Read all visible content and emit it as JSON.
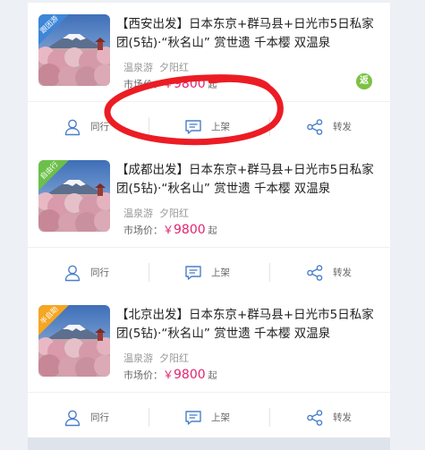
{
  "colors": {
    "price_accent": "#e0256f",
    "badge_blue": "#3d86d8",
    "badge_green": "#6cc04a",
    "badge_orange": "#f5a623",
    "fan_badge": "#7cc242",
    "annotation_red": "#ec1c24"
  },
  "cards": [
    {
      "badge": "跟团游",
      "title": "【西安出发】日本东京+群马县+日光市5日私家团(5钻)·“秋名山” 赏世遗 千本樱 双温泉",
      "tags": [
        "温泉游",
        "夕阳红"
      ],
      "price_label": "市场价：",
      "currency": "￥",
      "price": "9800",
      "price_suffix": "起",
      "fan_badge": "返",
      "actions": {
        "peer": "同行",
        "list": "上架",
        "share": "转发"
      }
    },
    {
      "badge": "自由行",
      "title": "【成都出发】日本东京+群马县+日光市5日私家团(5钻)·“秋名山” 赏世遗 千本樱 双温泉",
      "tags": [
        "温泉游",
        "夕阳红"
      ],
      "price_label": "市场价：",
      "currency": "￥",
      "price": "9800",
      "price_suffix": "起",
      "actions": {
        "peer": "同行",
        "list": "上架",
        "share": "转发"
      }
    },
    {
      "badge": "半自助",
      "title": "【北京出发】日本东京+群马县+日光市5日私家团(5钻)·“秋名山” 赏世遗 千本樱 双温泉",
      "tags": [
        "温泉游",
        "夕阳红"
      ],
      "price_label": "市场价：",
      "currency": "￥",
      "price": "9800",
      "price_suffix": "起",
      "actions": {
        "peer": "同行",
        "list": "上架",
        "share": "转发"
      }
    }
  ],
  "icons": {
    "peer": "person-icon",
    "list": "message-icon",
    "share": "share-icon"
  }
}
